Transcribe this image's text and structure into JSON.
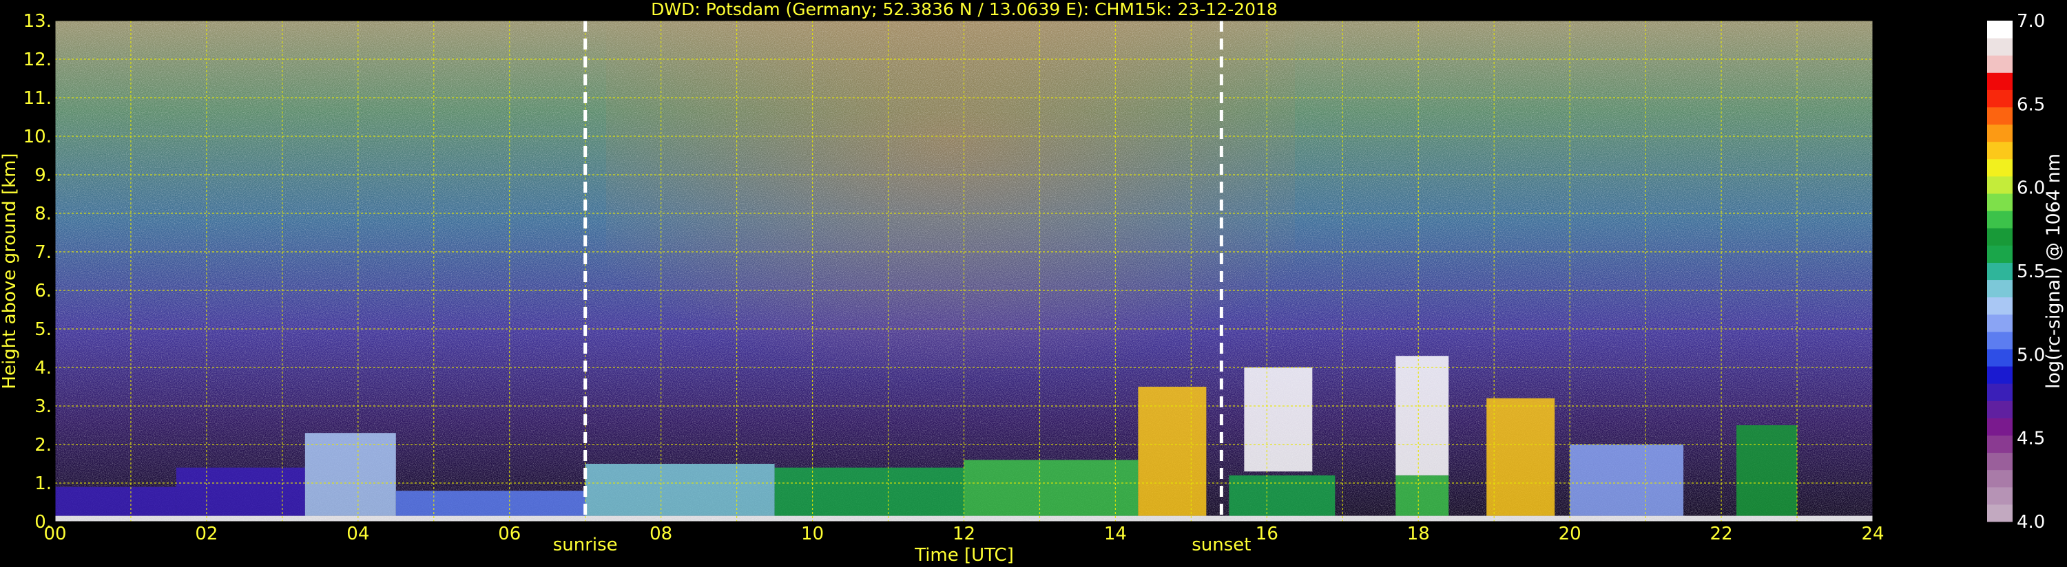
{
  "chart_data": {
    "type": "heatmap",
    "title": "DWD: Potsdam (Germany; 52.3836 N / 13.0639 E):    CHM15k: 23-12-2018",
    "xlabel": "Time [UTC]",
    "ylabel": "Height above ground [km]",
    "xlim": [
      0,
      24
    ],
    "ylim": [
      0,
      13
    ],
    "x_ticks": [
      "00",
      "02",
      "04",
      "06",
      "08",
      "10",
      "12",
      "14",
      "16",
      "18",
      "20",
      "22",
      "24"
    ],
    "y_ticks": [
      "0.",
      "1.",
      "2.",
      "3.",
      "4.",
      "5.",
      "6.",
      "7.",
      "8.",
      "9.",
      "10.",
      "11.",
      "12.",
      "13."
    ],
    "grid": true,
    "annotations": [
      {
        "label": "sunrise",
        "x": 7.0
      },
      {
        "label": "sunset",
        "x": 15.4
      }
    ],
    "colorbar": {
      "label": "log(rc-signal) @ 1064 nm",
      "range": [
        4.0,
        7.0
      ],
      "ticks": [
        "4.0",
        "4.5",
        "5.0",
        "5.5",
        "6.0",
        "6.5",
        "7.0"
      ],
      "colors": [
        "#c2a9c0",
        "#b693b5",
        "#a97ba8",
        "#9a5f9b",
        "#8a3a91",
        "#7a1a8e",
        "#6020a0",
        "#3a1fb8",
        "#1a1ad0",
        "#2e4ee6",
        "#5c7df0",
        "#8aa4f4",
        "#a9c7f4",
        "#7cc8d8",
        "#2fb59a",
        "#1aa64a",
        "#189a38",
        "#3cc24a",
        "#7ee04a",
        "#c4ec3a",
        "#f2f01e",
        "#fcc81a",
        "#fc9a14",
        "#fc6410",
        "#f8280c",
        "#f00808",
        "#f2c2c2",
        "#ece2e2",
        "#ffffff"
      ]
    },
    "features": [
      {
        "x0": 0.0,
        "x1": 24.0,
        "y0": 0.0,
        "y1": 0.15,
        "value": 7.0
      },
      {
        "x0": 0.0,
        "x1": 1.6,
        "y0": 0.15,
        "y1": 0.9,
        "value": 4.7
      },
      {
        "x0": 1.6,
        "x1": 3.3,
        "y0": 0.15,
        "y1": 1.4,
        "value": 4.8
      },
      {
        "x0": 3.3,
        "x1": 4.5,
        "y0": 0.15,
        "y1": 2.3,
        "value": 5.3
      },
      {
        "x0": 4.5,
        "x1": 7.0,
        "y0": 0.15,
        "y1": 0.8,
        "value": 5.1
      },
      {
        "x0": 7.0,
        "x1": 9.5,
        "y0": 0.15,
        "y1": 1.5,
        "value": 5.4
      },
      {
        "x0": 9.5,
        "x1": 12.0,
        "y0": 0.15,
        "y1": 1.4,
        "value": 5.6
      },
      {
        "x0": 12.0,
        "x1": 14.3,
        "y0": 0.15,
        "y1": 1.6,
        "value": 5.8
      },
      {
        "x0": 14.3,
        "x1": 15.2,
        "y0": 0.15,
        "y1": 3.5,
        "value": 6.2
      },
      {
        "x0": 15.7,
        "x1": 16.6,
        "y0": 1.3,
        "y1": 4.0,
        "value": 7.0
      },
      {
        "x0": 15.5,
        "x1": 16.9,
        "y0": 0.15,
        "y1": 1.2,
        "value": 5.6
      },
      {
        "x0": 17.7,
        "x1": 18.4,
        "y0": 1.2,
        "y1": 4.3,
        "value": 7.0
      },
      {
        "x0": 17.7,
        "x1": 18.4,
        "y0": 0.15,
        "y1": 1.2,
        "value": 5.8
      },
      {
        "x0": 18.9,
        "x1": 19.8,
        "y0": 0.15,
        "y1": 3.2,
        "value": 6.2
      },
      {
        "x0": 20.0,
        "x1": 21.5,
        "y0": 0.15,
        "y1": 2.0,
        "value": 5.2
      },
      {
        "x0": 22.2,
        "x1": 23.0,
        "y0": 0.15,
        "y1": 2.5,
        "value": 5.7
      }
    ]
  }
}
